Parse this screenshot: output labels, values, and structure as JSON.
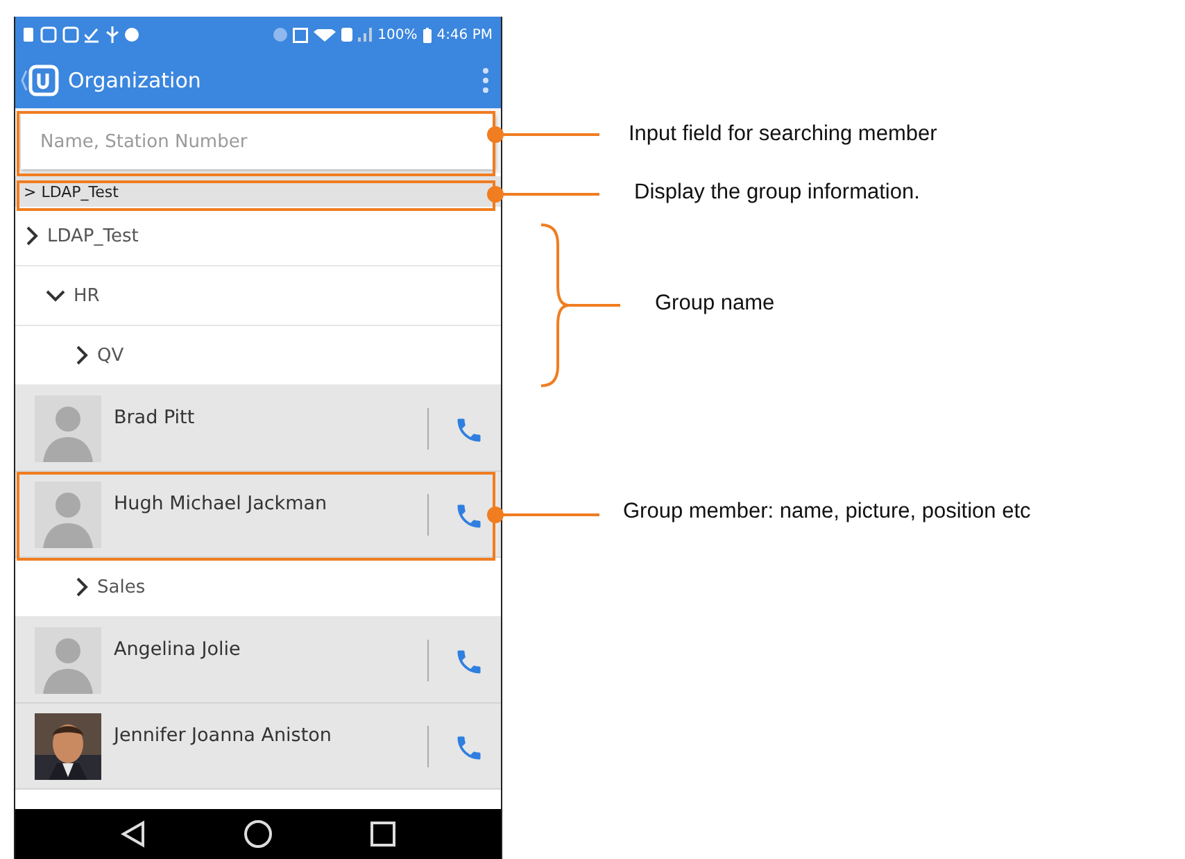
{
  "status_bar": {
    "battery": "100%",
    "time": "4:46 PM"
  },
  "app_bar": {
    "title": "Organization"
  },
  "search": {
    "placeholder": "Name, Station Number"
  },
  "breadcrumb": "> LDAP_Test",
  "tree": [
    {
      "kind": "group",
      "label": "LDAP_Test",
      "expanded": false,
      "children": [
        {
          "kind": "group",
          "label": "HR",
          "expanded": true,
          "children": [
            {
              "kind": "group",
              "label": "QV",
              "expanded": false
            },
            {
              "kind": "member",
              "name": "Brad Pitt",
              "photo": false
            },
            {
              "kind": "member",
              "name": "Hugh Michael Jackman",
              "photo": false
            },
            {
              "kind": "group",
              "label": "Sales",
              "expanded": false
            },
            {
              "kind": "member",
              "name": "Angelina Jolie",
              "photo": false
            },
            {
              "kind": "member",
              "name": "Jennifer Joanna Aniston",
              "photo": true
            }
          ]
        }
      ]
    }
  ],
  "annotations": [
    {
      "label": "Input field for searching member"
    },
    {
      "label": "Display the group information."
    },
    {
      "label": "Group name"
    },
    {
      "label": "Group member: name, picture, position etc"
    }
  ]
}
